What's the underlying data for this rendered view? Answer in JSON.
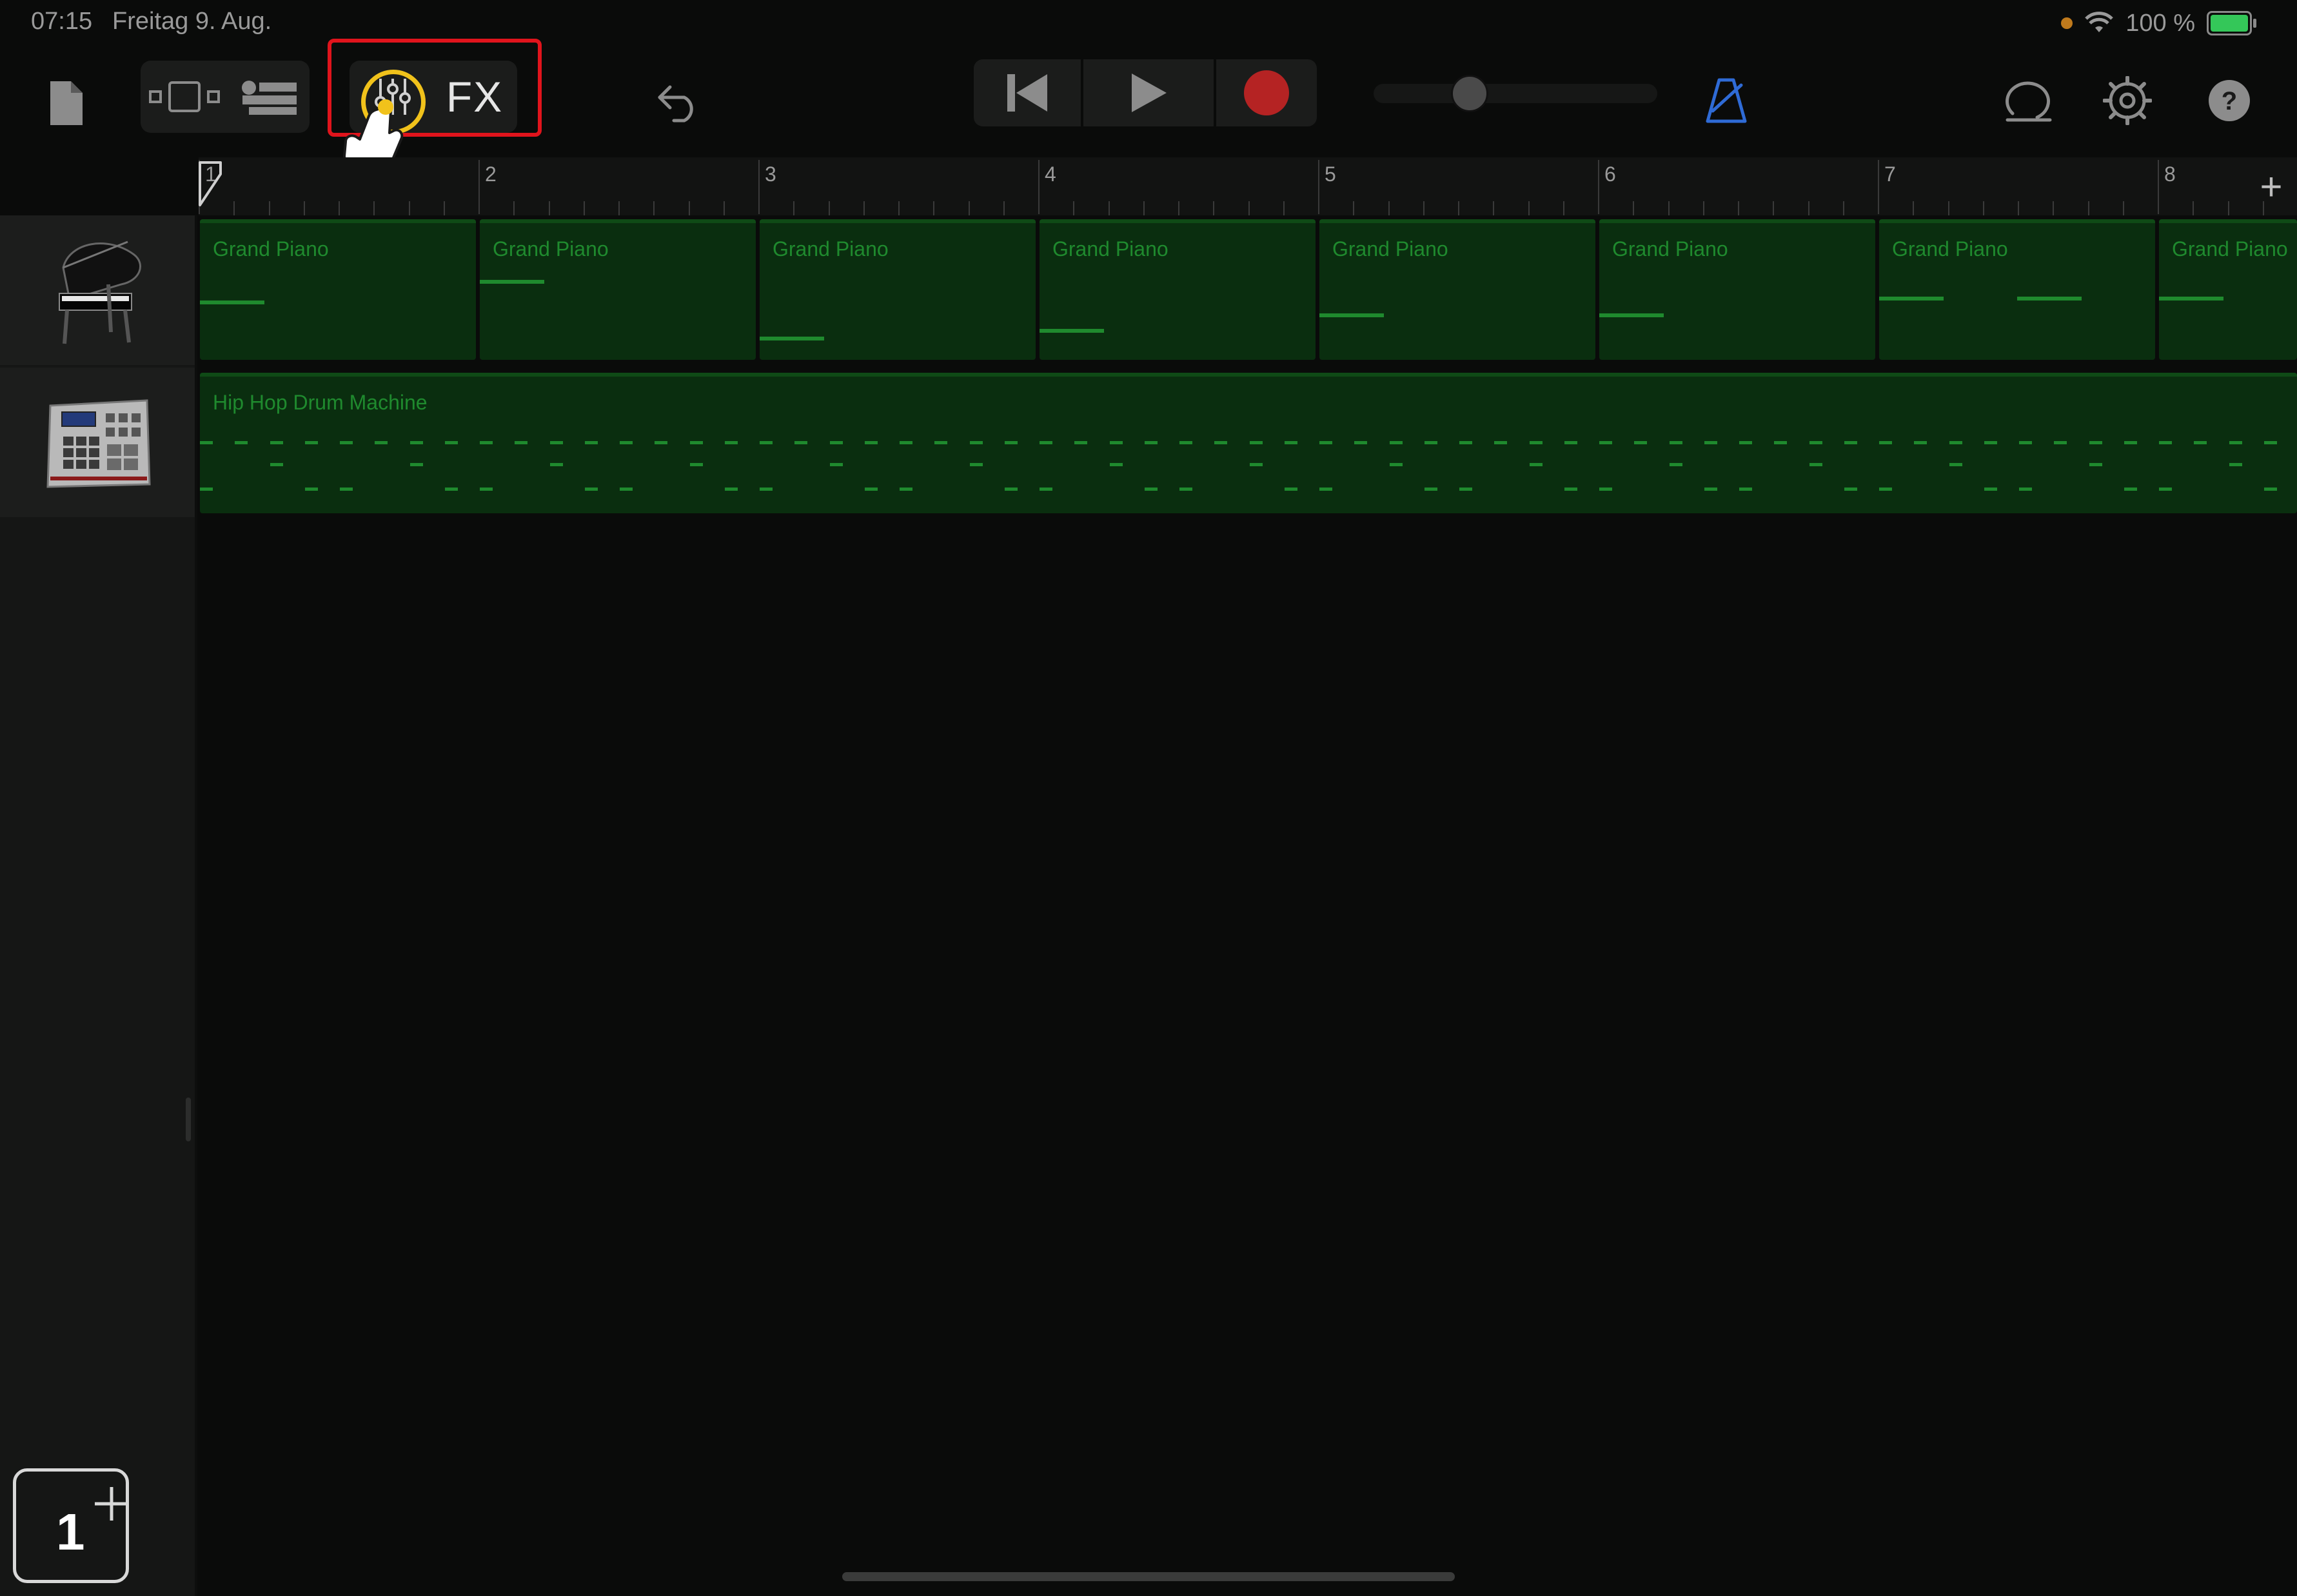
{
  "status_bar": {
    "time": "07:15",
    "date": "Freitag 9. Aug.",
    "battery": "100 %",
    "battery_level": 1.0,
    "wifi_icon": "wifi-icon",
    "recording_indicator_color": "#c07a1c"
  },
  "toolbar": {
    "fx_label": "FX",
    "icons": [
      "document-icon",
      "view-toggle-icon",
      "track-controls-icon",
      "mixer-icon",
      "undo-icon",
      "rewind-icon",
      "play-icon",
      "record-icon",
      "metronome-icon",
      "loop-icon",
      "settings-icon",
      "help-icon"
    ],
    "record_color": "#b52323",
    "metronome_color": "#2f6bd6",
    "highlight_color": "#e0141c",
    "mixer_ring_color": "#f1c21b",
    "volume_level": 0.3
  },
  "ruler": {
    "bars": [
      "1",
      "2",
      "3",
      "4",
      "5",
      "6",
      "7",
      "8"
    ],
    "add_label": "+"
  },
  "tracks": [
    {
      "name": "Grand Piano",
      "icon": "grand-piano-icon",
      "regions": [
        "Grand Piano",
        "Grand Piano",
        "Grand Piano",
        "Grand Piano",
        "Grand Piano",
        "Grand Piano",
        "Grand Piano",
        "Grand Piano"
      ]
    },
    {
      "name": "Hip Hop Drum Machine",
      "icon": "drum-machine-icon",
      "regions": [
        "Hip Hop Drum Machine"
      ]
    }
  ],
  "region_color": "#0a2e0f",
  "note_color": "#1f8a2e",
  "track_count": "1"
}
